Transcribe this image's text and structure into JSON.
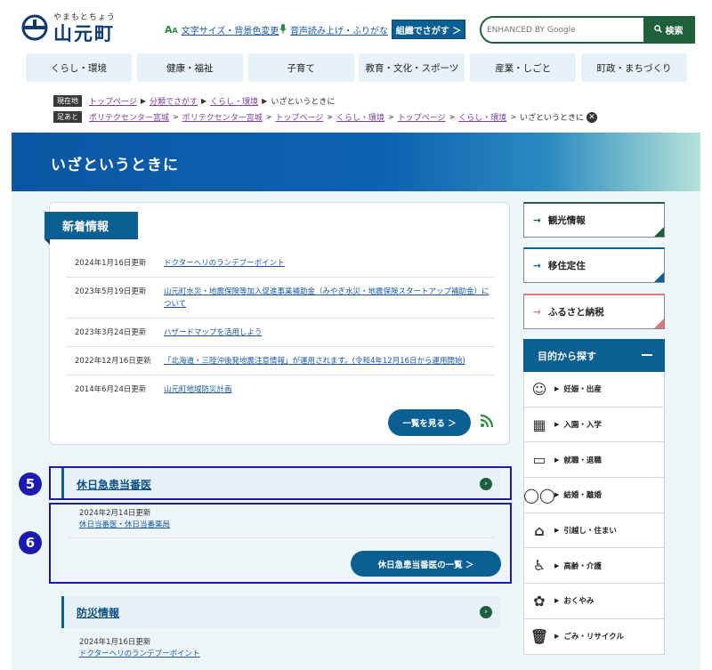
{
  "header": {
    "logo_kana": "やまもとちょう",
    "logo_name": "山元町",
    "text_size_link": "文字サイズ・背景色変更",
    "voice_link": "音声読み上げ・ふりがな",
    "org_button": "組織でさがす ＞",
    "search_placeholder": "ENHANCED BY Google",
    "search_button": "検索",
    "text_size_icon": "font-size-icon",
    "voice_icon": "microphone-icon"
  },
  "nav": [
    "くらし・環境",
    "健康・福祉",
    "子育て",
    "教育・文化・スポーツ",
    "産業・しごと",
    "町政・まちづくり"
  ],
  "breadcrumb": {
    "current_tag": "現在地",
    "current": [
      "トップページ",
      "分類でさがす",
      "くらし・環境",
      "いざというときに"
    ],
    "history_tag": "足あと",
    "history": [
      "ポリテクセンター宮城",
      "ポリテクセンター宮城",
      "トップページ",
      "くらし・環境",
      "トップページ",
      "くらし・環境",
      "いざというときに"
    ]
  },
  "page_title": "いざというときに",
  "news": {
    "heading": "新着情報",
    "items": [
      {
        "date": "2024年1月16日更新",
        "title": "ドクターヘリのランデブーポイント"
      },
      {
        "date": "2023年5月19日更新",
        "title": "山元町水災・地震保険等加入促進事業補助金（みやぎ水災・地震保険スタートアップ補助金）について"
      },
      {
        "date": "2023年3月24日更新",
        "title": "ハザードマップを活用しよう"
      },
      {
        "date": "2022年12月16日更新",
        "title": "「北海道・三陸沖後発地震注意情報」が運用されます。(令和4年12月16日から運用開始)"
      },
      {
        "date": "2014年6月24日更新",
        "title": "山元町地域防災計画"
      }
    ],
    "more_button": "一覧を見る ＞",
    "rss_icon": "rss-icon"
  },
  "sections": {
    "holiday": {
      "marker": "5",
      "title": "休日急患当番医",
      "entry_date": "2024年2月14日更新",
      "entry_title": "休日当番医・休日当番薬局",
      "list_marker": "6",
      "list_button": "休日急患当番医の一覧 ＞"
    },
    "disaster": {
      "title": "防災情報",
      "entry_date": "2024年1月16日更新",
      "entry_title": "ドクターヘリのランデブーポイント"
    }
  },
  "side_links": [
    {
      "label": "観光情報",
      "color": "#1f5f3a"
    },
    {
      "label": "移住定住",
      "color": "#0b5f92"
    },
    {
      "label": "ふるさと納税",
      "color": "#e07a7a"
    }
  ],
  "purpose": {
    "heading": "目的から探す",
    "items": [
      {
        "label": "妊娠・出産",
        "icon": "baby-icon"
      },
      {
        "label": "入園・入学",
        "icon": "school-icon"
      },
      {
        "label": "就職・退職",
        "icon": "briefcase-icon"
      },
      {
        "label": "結婚・離婚",
        "icon": "rings-icon"
      },
      {
        "label": "引越し・住まい",
        "icon": "house-icon"
      },
      {
        "label": "高齢・介護",
        "icon": "wheelchair-icon"
      },
      {
        "label": "おくやみ",
        "icon": "wreath-icon"
      },
      {
        "label": "ごみ・リサイクル",
        "icon": "trash-icon"
      }
    ]
  }
}
